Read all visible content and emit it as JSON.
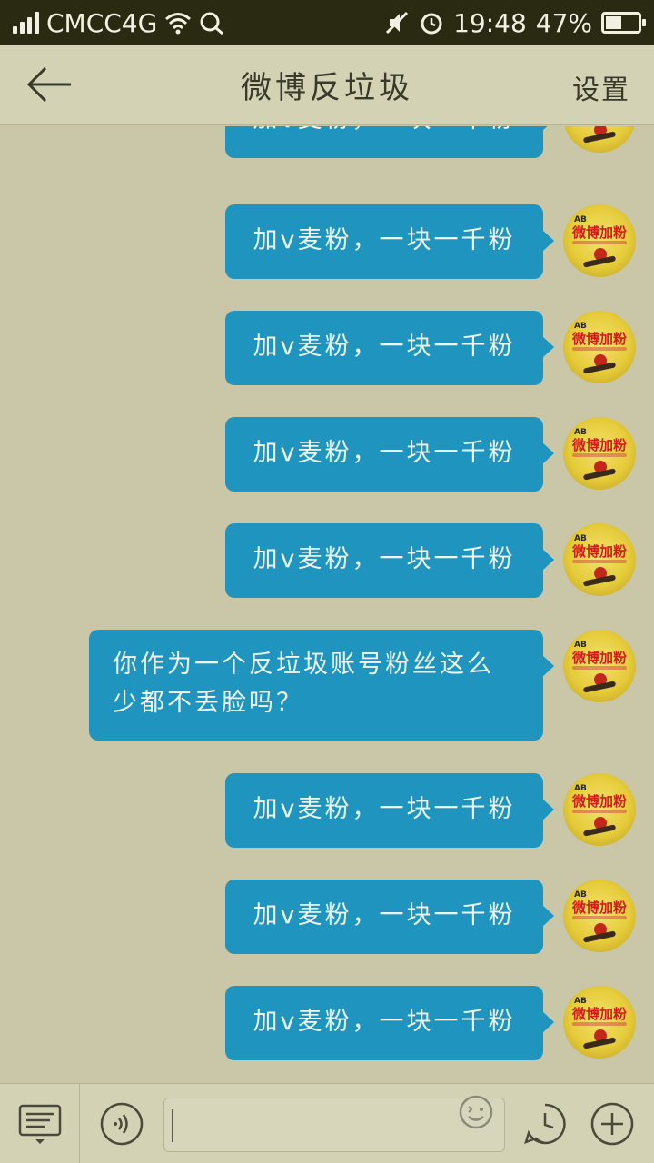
{
  "status_bar": {
    "carrier": "CMCC4G",
    "time": "19:48",
    "battery": "47%"
  },
  "header": {
    "title": "微博反垃圾",
    "settings": "设置"
  },
  "messages": [
    {
      "text": "加v麦粉，一块一千粉"
    },
    {
      "text": "加v麦粉，一块一千粉"
    },
    {
      "text": "加v麦粉，一块一千粉"
    },
    {
      "text": "加v麦粉，一块一千粉"
    },
    {
      "text": "加v麦粉，一块一千粉"
    },
    {
      "text": "你作为一个反垃圾账号粉丝这么少都不丢脸吗？"
    },
    {
      "text": "加v麦粉，一块一千粉"
    },
    {
      "text": "加v麦粉，一块一千粉"
    },
    {
      "text": "加v麦粉，一块一千粉"
    }
  ],
  "avatar": {
    "badge": "AB",
    "text": "微博加粉"
  },
  "input": {
    "value": "",
    "placeholder": ""
  },
  "icons": {
    "back": "back-arrow-icon",
    "keyboard": "keyboard-icon",
    "voice": "voice-icon",
    "emoji": "emoji-icon",
    "clock": "clock-icon",
    "plus": "plus-icon"
  },
  "colors": {
    "bubble": "#1f94be",
    "background": "#c9c7a8",
    "status_bar": "#2a2a12"
  }
}
